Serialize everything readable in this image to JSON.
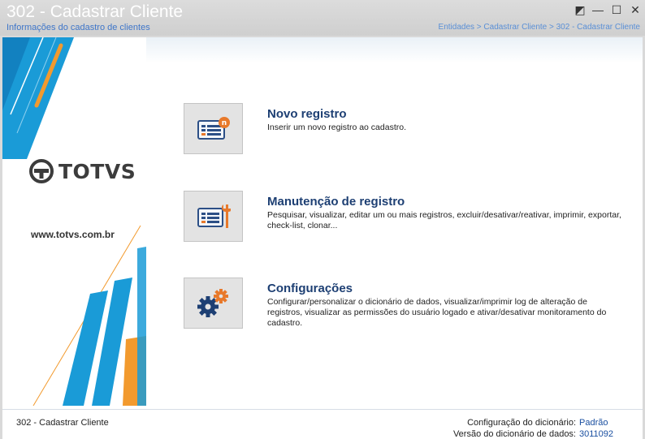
{
  "window": {
    "title": "302 - Cadastrar Cliente",
    "subtitle": "Informações do cadastro de clientes",
    "breadcrumb": "Entidades > Cadastrar Cliente > 302 - Cadastrar Cliente",
    "controls": {
      "restore": "◩",
      "minimize": "—",
      "maximize": "☐",
      "close": "✕"
    }
  },
  "brand": {
    "logo_text": "TOTVS",
    "website": "www.totvs.com.br",
    "colors": {
      "blue": "#1a9bd7",
      "orange": "#f29a2e",
      "dark": "#3c3c3c"
    }
  },
  "options": [
    {
      "icon": "new-record-icon",
      "title": "Novo registro",
      "description": "Inserir um novo registro ao cadastro."
    },
    {
      "icon": "maintenance-icon",
      "title": "Manutenção de registro",
      "description": "Pesquisar, visualizar, editar um ou mais registros, excluir/desativar/reativar, imprimir, exportar, check-list,  clonar..."
    },
    {
      "icon": "settings-gears-icon",
      "title": "Configurações",
      "description": "Configurar/personalizar o dicionário de dados, visualizar/imprimir log de alteração de registros, visualizar as permissões do usuário logado e ativar/desativar monitoramento do cadastro."
    }
  ],
  "footer": {
    "left": "302 - Cadastrar Cliente",
    "config_label": "Configuração do dicionário:",
    "config_value": "Padrão",
    "version_label": "Versão do dicionário de dados:",
    "version_value": "3011092"
  }
}
